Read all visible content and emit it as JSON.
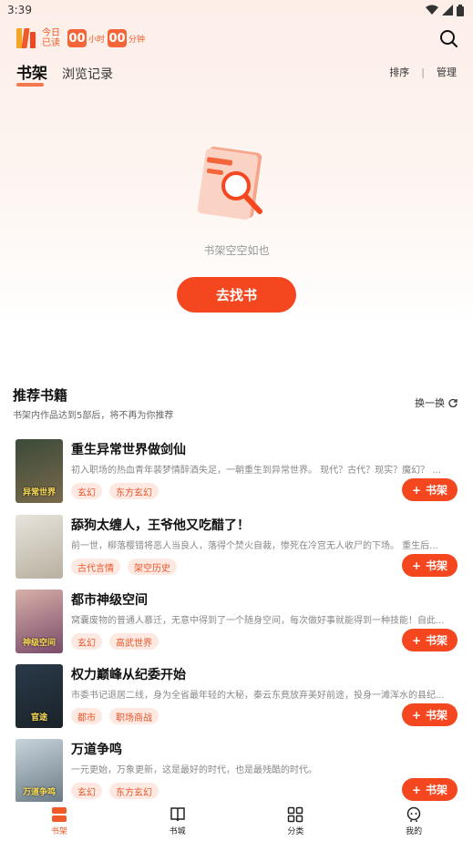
{
  "status": {
    "time": "3:39"
  },
  "reading": {
    "today_label": "今日已读",
    "hours": "00",
    "hours_unit": "小时",
    "minutes": "00",
    "minutes_unit": "分钟"
  },
  "tabs": {
    "active": "书架",
    "inactive": "浏览记录"
  },
  "top_actions": {
    "sort": "排序",
    "separator": "|",
    "manage": "管理"
  },
  "empty": {
    "text": "书架空空如也",
    "button": "去找书"
  },
  "recommend": {
    "title": "推荐书籍",
    "subtitle": "书架内作品达到5部后，将不再为你推荐",
    "swap": "换一换"
  },
  "books": [
    {
      "title": "重生异常世界做剑仙",
      "desc": "初入职场的热血青年裴梦情醉酒失足，一朝重生到异常世界。 现代？古代？现实？魔幻？ ...",
      "tags": [
        "玄幻",
        "东方玄幻"
      ],
      "cover_text": "异常世界",
      "cover_colors": [
        "#3a4a3a",
        "#7a6a4a"
      ]
    },
    {
      "title": "舔狗太缠人，王爷他又吃醋了！",
      "desc": "前一世，柳落樱错将恶人当良人，落得个焚火自裁，惨死在冷宫无人收尸的下场。 重生后...",
      "tags": [
        "古代言情",
        "架空历史"
      ],
      "cover_text": "",
      "cover_colors": [
        "#e8e4dc",
        "#b8b0a0"
      ]
    },
    {
      "title": "都市神级空间",
      "desc": "窝囊废物的普通人慕迁，无意中得到了一个随身空间，每次做好事就能得到一种技能！自此...",
      "tags": [
        "玄幻",
        "高武世界"
      ],
      "cover_text": "神级空间",
      "cover_colors": [
        "#d8b0a8",
        "#7a4a6a"
      ]
    },
    {
      "title": "权力巅峰从纪委开始",
      "desc": "市委书记退居二线，身为全省最年轻的大秘，秦云东竟放弃美好前途，投身一滩浑水的县纪...",
      "tags": [
        "都市",
        "职场商战"
      ],
      "cover_text": "官途",
      "cover_colors": [
        "#2a3a4a",
        "#1a2228"
      ]
    },
    {
      "title": "万道争鸣",
      "desc": "一元更始，万象更新，这是最好的时代，也是最残酷的时代。",
      "tags": [
        "玄幻",
        "东方玄幻"
      ],
      "cover_text": "万道争鸣",
      "cover_colors": [
        "#c8d4dc",
        "#6a7a84"
      ]
    }
  ],
  "add_label": "书架",
  "nav": [
    {
      "label": "书架",
      "icon": "bookshelf-icon"
    },
    {
      "label": "书城",
      "icon": "book-icon"
    },
    {
      "label": "分类",
      "icon": "grid-icon"
    },
    {
      "label": "我的",
      "icon": "profile-icon"
    }
  ],
  "colors": {
    "accent": "#f4461f",
    "tag_bg": "#fde9e2"
  }
}
